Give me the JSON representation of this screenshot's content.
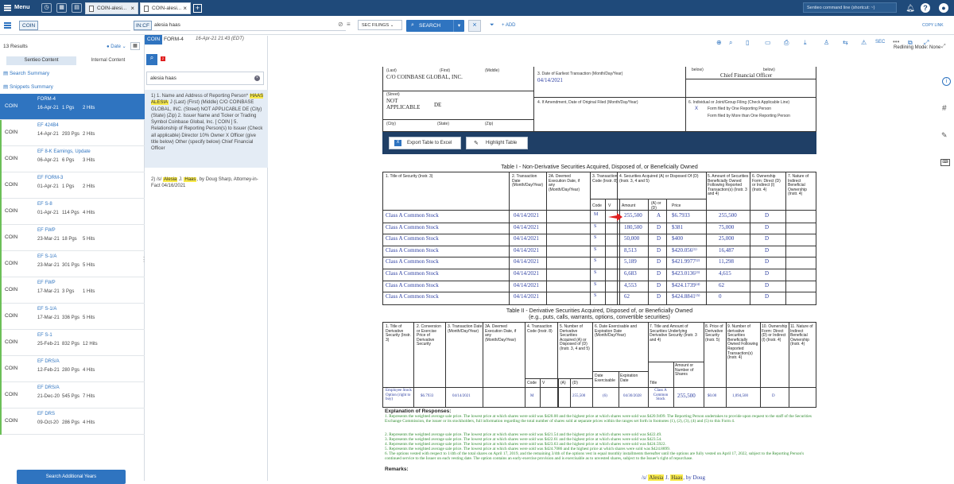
{
  "topbar": {
    "menu": "Menu",
    "tabs": [
      {
        "label": "COIN-alesi..."
      },
      {
        "label": "COIN-alesi..."
      }
    ],
    "cmd_placeholder": "Sentieo command line (shortcut: ~)",
    "help": "?"
  },
  "query": {
    "ticker": "COIN",
    "filter": "IN:CF",
    "search_text": "alesia haas",
    "sec_filings": "SEC FILINGS",
    "search_label": "SEARCH",
    "add": "+ ADD",
    "copy_link": "COPY LINK"
  },
  "results": {
    "count": "13 Results",
    "sort": "Date",
    "tab_content": "Sentieo Content",
    "tab_internal": "Internal Content",
    "search_summary": "Search Summary",
    "snippets_summary": "Snippets Summary",
    "add_years": "Search Additional Years",
    "rows": [
      {
        "co": "COIN",
        "type": "FORM-4",
        "date": "16-Apr-21",
        "pages": "1 Pgs",
        "hits": "2 Hits"
      },
      {
        "co": "COIN",
        "type": "EF 424B4",
        "date": "14-Apr-21",
        "pages": "293 Pgs",
        "hits": "2 Hits"
      },
      {
        "co": "COIN",
        "type": "EF 8-K Earnings, Update",
        "date": "06-Apr-21",
        "pages": "6 Pgs",
        "hits": "3 Hits"
      },
      {
        "co": "COIN",
        "type": "EF FORM-3",
        "date": "01-Apr-21",
        "pages": "1 Pgs",
        "hits": "2 Hits"
      },
      {
        "co": "COIN",
        "type": "EF S-8",
        "date": "01-Apr-21",
        "pages": "114 Pgs",
        "hits": "4 Hits"
      },
      {
        "co": "COIN",
        "type": "EF FWP",
        "date": "23-Mar-21",
        "pages": "18 Pgs",
        "hits": "5 Hits"
      },
      {
        "co": "COIN",
        "type": "EF S-1/A",
        "date": "23-Mar-21",
        "pages": "301 Pgs",
        "hits": "5 Hits"
      },
      {
        "co": "COIN",
        "type": "EF FWP",
        "date": "17-Mar-21",
        "pages": "3 Pgs",
        "hits": "1 Hits"
      },
      {
        "co": "COIN",
        "type": "EF S-1/A",
        "date": "17-Mar-21",
        "pages": "336 Pgs",
        "hits": "5 Hits"
      },
      {
        "co": "COIN",
        "type": "EF S-1",
        "date": "25-Feb-21",
        "pages": "832 Pgs",
        "hits": "12 Hits"
      },
      {
        "co": "COIN",
        "type": "EF DRS/A",
        "date": "12-Feb-21",
        "pages": "280 Pgs",
        "hits": "4 Hits"
      },
      {
        "co": "COIN",
        "type": "EF DRS/A",
        "date": "21-Dec-20",
        "pages": "545 Pgs",
        "hits": "7 Hits"
      },
      {
        "co": "COIN",
        "type": "EF DRS",
        "date": "09-Oct-20",
        "pages": "286 Pgs",
        "hits": "4 Hits"
      }
    ]
  },
  "snippets": {
    "search": "alesia haas",
    "s1_pre": "1) 1. Name and Address of Reporting Person*",
    "s1_hl": "HAAS ALESIA",
    "s1_post": "J (Last) (First) (Middle) C/O COINBASE GLOBAL, INC. (Street) NOT APPLICABLE DE (City) (State) (Zip) 2. Issuer Name and Ticker or Trading Symbol Coinbase Global, Inc. [ COIN ] 5. Relationship of Reporting Person(s) to Issuer (Check all applicable) Director 10% Owner X Officer (give title below) Other (specify below) Chief Financial Officer",
    "s2_pre": "2) /s/",
    "s2_hl1": "Alesia",
    "s2_mid": "J.",
    "s2_hl2": "Haas",
    "s2_post": ", by Doug Sharp, Attorney-in-Fact 04/16/2021"
  },
  "doc": {
    "ticker": "COIN",
    "title": "FORM-4",
    "timestamp": "16-Apr-21 21:43 (EDT)",
    "redlining": "Redlining Mode: None",
    "sec": "SEC",
    "addr_last": "(Last)",
    "addr_first": "(First)",
    "addr_middle": "(Middle)",
    "addr_co": "C/O COINBASE GLOBAL, INC.",
    "street": "(Street)",
    "not_applicable": "NOT APPLICABLE",
    "state_val": "DE",
    "city": "(City)",
    "state": "(State)",
    "zip": "(Zip)",
    "earliest_label": "3. Date of Earliest Transaction (Month/Day/Year)",
    "earliest_val": "04/14/2021",
    "amend_label": "4. If Amendment, Date of Original Filed (Month/Day/Year)",
    "below1": "below)",
    "below2": "below)",
    "cfo": "Chief Financial Officer",
    "joint_label": "6. Individual or Joint/Group Filing (Check Applicable Line)",
    "joint_x": "X",
    "joint_one": "Form filed by One Reporting Person",
    "joint_more": "Form filed by More than One Reporting Person",
    "export": "Export Table to Excel",
    "highlight": "Highlight Table",
    "t1_title": "Table I - Non-Derivative Securities Acquired, Disposed of, or Beneficially Owned",
    "t1_h1": "1. Title of Security (Instr. 3)",
    "t1_h2": "2. Transaction Date (Month/Day/Year)",
    "t1_h2a": "2A. Deemed Execution Date, if any (Month/Day/Year)",
    "t1_h3": "3. Transaction Code (Instr. 8)",
    "t1_h4": "4. Securities Acquired (A) or Disposed Of (D) (Instr. 3, 4 and 5)",
    "t1_h5": "5. Amount of Securities Beneficially Owned Following Reported Transaction(s) (Instr. 3 and 4)",
    "t1_h6": "6. Ownership Form: Direct (D) or Indirect (I) (Instr. 4)",
    "t1_h7": "7. Nature of Indirect Beneficial Ownership (Instr. 4)",
    "t1_sub_code": "Code",
    "t1_sub_v": "V",
    "t1_sub_amt": "Amount",
    "t1_sub_ad": "(A) or (D)",
    "t1_sub_price": "Price",
    "t1_rows": [
      {
        "title": "Class A Common Stock",
        "date": "04/14/2021",
        "code": "M",
        "amt": "255,500",
        "ad": "A",
        "price": "$6.7933",
        "owned": "255,500",
        "form": "D"
      },
      {
        "title": "Class A Common Stock",
        "date": "04/14/2021",
        "code": "S",
        "amt": "180,500",
        "ad": "D",
        "price": "$381",
        "owned": "75,000",
        "form": "D"
      },
      {
        "title": "Class A Common Stock",
        "date": "04/14/2021",
        "code": "S",
        "amt": "50,000",
        "ad": "D",
        "price": "$400",
        "owned": "25,000",
        "form": "D"
      },
      {
        "title": "Class A Common Stock",
        "date": "04/14/2021",
        "code": "S",
        "amt": "8,513",
        "ad": "D",
        "price": "$420.056⁽¹⁾",
        "owned": "16,487",
        "form": "D"
      },
      {
        "title": "Class A Common Stock",
        "date": "04/14/2021",
        "code": "S",
        "amt": "5,189",
        "ad": "D",
        "price": "$421.9977⁽²⁾",
        "owned": "11,298",
        "form": "D"
      },
      {
        "title": "Class A Common Stock",
        "date": "04/14/2021",
        "code": "S",
        "amt": "6,683",
        "ad": "D",
        "price": "$423.0136⁽³⁾",
        "owned": "4,615",
        "form": "D"
      },
      {
        "title": "Class A Common Stock",
        "date": "04/14/2021",
        "code": "S",
        "amt": "4,553",
        "ad": "D",
        "price": "$424.1739⁽⁴⁾",
        "owned": "62",
        "form": "D"
      },
      {
        "title": "Class A Common Stock",
        "date": "04/14/2021",
        "code": "S",
        "amt": "62",
        "ad": "D",
        "price": "$424.8841⁽⁵⁾",
        "owned": "0",
        "form": "D"
      }
    ],
    "t2_title": "Table II - Derivative Securities Acquired, Disposed of, or Beneficially Owned",
    "t2_sub": "(e.g., puts, calls, warrants, options, convertible securities)",
    "t2_h1": "1. Title of Derivative Security (Instr. 3)",
    "t2_h2": "2. Conversion or Exercise Price of Derivative Security",
    "t2_h3": "3. Transaction Date (Month/Day/Year)",
    "t2_h3a": "3A. Deemed Execution Date, if any (Month/Day/Year)",
    "t2_h4": "4. Transaction Code (Instr. 8)",
    "t2_h5": "5. Number of Derivative Securities Acquired (A) or Disposed of (D) (Instr. 3, 4 and 5)",
    "t2_h6": "6. Date Exercisable and Expiration Date (Month/Day/Year)",
    "t2_h7": "7. Title and Amount of Securities Underlying Derivative Security (Instr. 3 and 4)",
    "t2_h8": "8. Price of Derivative Security (Instr. 5)",
    "t2_h9": "9. Number of derivative Securities Beneficially Owned Following Reported Transaction(s) (Instr. 4)",
    "t2_h10": "10. Ownership Form: Direct (D) or Indirect (I) (Instr. 4)",
    "t2_h11": "11. Nature of Indirect Beneficial Ownership (Instr. 4)",
    "t2_sub_code": "Code",
    "t2_sub_v": "V",
    "t2_sub_a": "(A)",
    "t2_sub_d": "(D)",
    "t2_sub_de": "Date Exercisable",
    "t2_sub_ed": "Expiration Date",
    "t2_sub_title": "Title",
    "t2_sub_amt": "Amount or Number of Shares",
    "t2_row": {
      "title": "Employee Stock Option (right to buy)",
      "conv": "$6.7933",
      "date": "04/14/2021",
      "code": "M",
      "d": "255,500",
      "de": "(6)",
      "ed": "04/30/2028",
      "sec": "Class A Common Stock",
      "amt": "255,500",
      "price": "$0.00",
      "owned": "1,094,500",
      "form": "D"
    },
    "expl": "Explanation of Responses:",
    "fn": [
      "1. Represents the weighted average sale price. The lowest price at which shares were sold was $420.00 and the highest price at which shares were sold was $420.9499. The Reporting Person undertakes to provide upon request to the staff of the Securities Exchange Commission, the issuer or its stockholders, full information regarding the total number of shares sold at separate prices within the ranges set forth in footnotes (1), (2), (3), (4) and (5) to this Form 4.",
      "2. Represents the weighted average sale price. The lowest price at which shares were sold was $421.54 and the highest price at which shares were sold was $422.49.",
      "3. Represents the weighted average sale price. The lowest price at which shares were sold was $422.61 and the highest price at which shares were sold was $423.54.",
      "4. Represents the weighted average sale price. The lowest price at which shares were sold was $423.63 and the highest price at which shares were sold was $424.5922.",
      "5. Represents the weighted average sale price. The lowest price at which shares were sold was $424.7086 and the highest price at which shares were sold was $424.8899.",
      "6. The options vested with respect to 1/4th of the total shares on April 17, 2019, and the remaining 3/4th of the options vest in equal monthly installments thereafter until the options are fully vested on April 17, 2022, subject to the Reporting Person's continued service to the Issuer on each vesting date. The option contains an early-exercise provision and is exercisable as to unvested shares, subject to the Issuer's right of repurchase."
    ],
    "remarks": "Remarks:",
    "sig_pre": "/s/",
    "sig_hl1": "Alesia",
    "sig_mid": "J.",
    "sig_hl2": "Haas",
    "sig_post": ", by Doug"
  },
  "colors": {
    "topbar": "#1f4a7a",
    "accent": "#2f74c0",
    "highlight": "#f7e94a",
    "doc_text": "#2c3ea1",
    "footnote": "#2f8c2f",
    "arrow": "#e02020"
  },
  "icons": [
    "menu-icon",
    "clock-icon",
    "grid-icon",
    "document-icon",
    "search-icon",
    "close-icon",
    "bell-icon",
    "help-icon",
    "user-icon",
    "filter-icon",
    "zoom-in-icon",
    "zoom-out-icon",
    "print-icon",
    "download-icon",
    "info-icon",
    "hashtag-icon",
    "pen-icon",
    "keyboard-icon",
    "excel-icon",
    "highlighter-icon",
    "red-arrow-icon"
  ]
}
